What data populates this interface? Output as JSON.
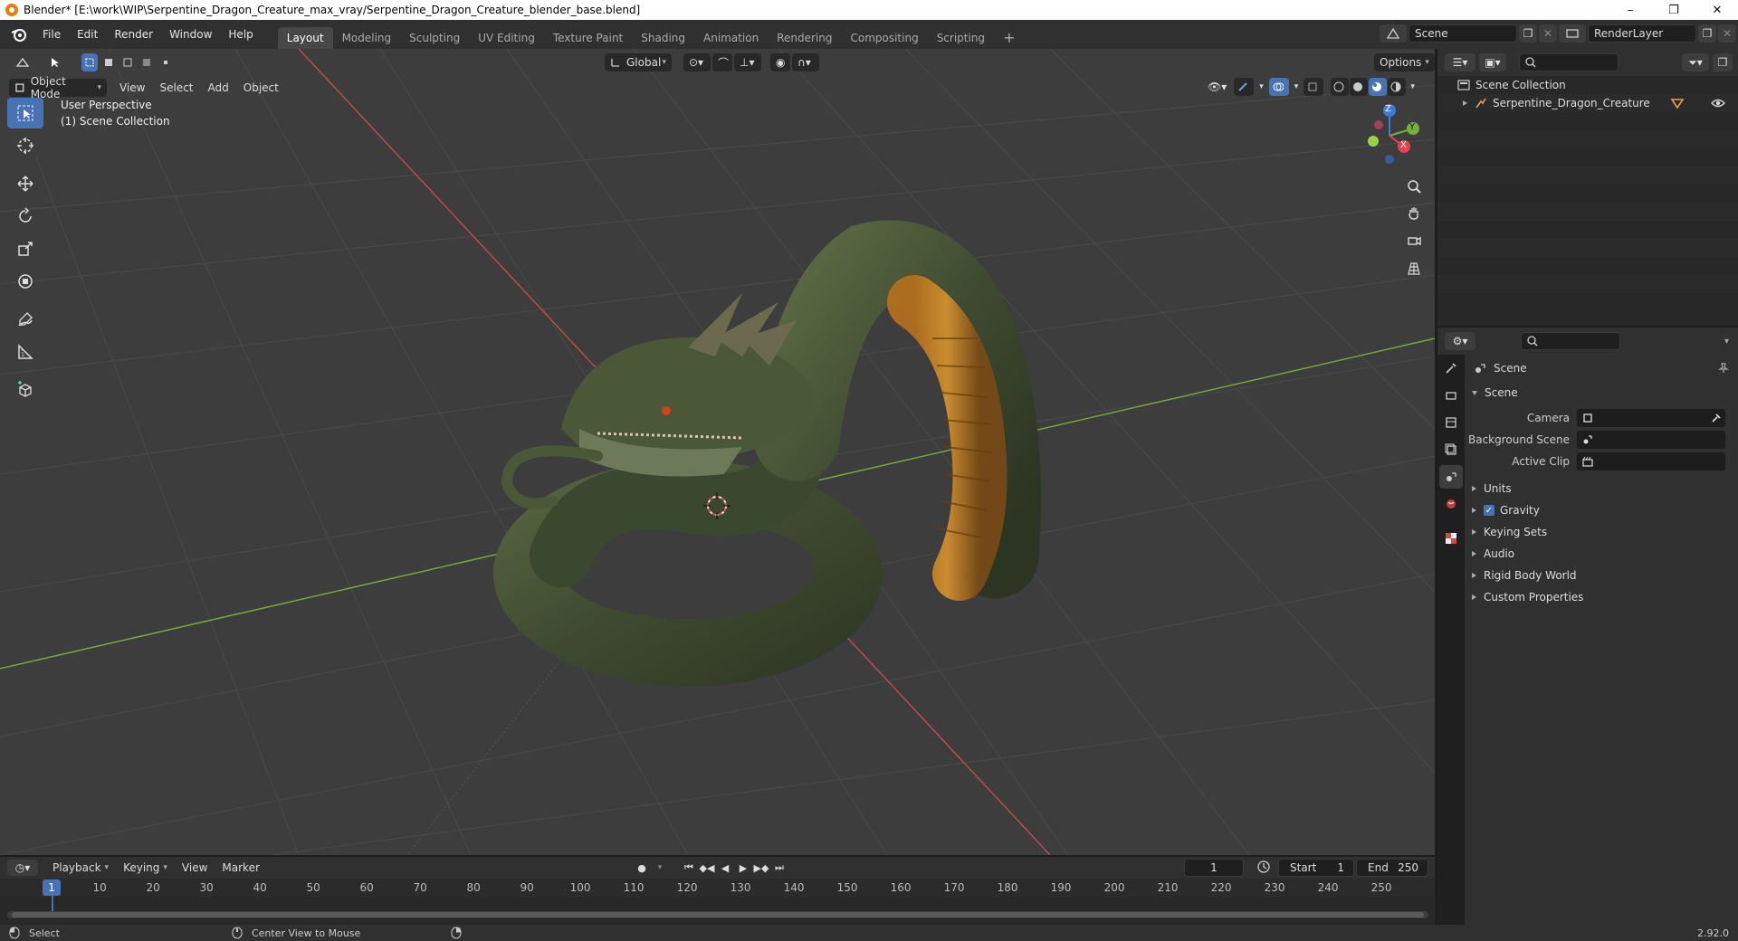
{
  "window": {
    "title": "Blender* [E:\\work\\WIP\\Serpentine_Dragon_Creature_max_vray/Serpentine_Dragon_Creature_blender_base.blend]",
    "minimize": "–",
    "maximize": "❐",
    "close": "✕"
  },
  "menu": [
    "File",
    "Edit",
    "Render",
    "Window",
    "Help"
  ],
  "workspaces": [
    {
      "label": "Layout",
      "active": true
    },
    {
      "label": "Modeling"
    },
    {
      "label": "Sculpting"
    },
    {
      "label": "UV Editing"
    },
    {
      "label": "Texture Paint"
    },
    {
      "label": "Shading"
    },
    {
      "label": "Animation"
    },
    {
      "label": "Rendering"
    },
    {
      "label": "Compositing"
    },
    {
      "label": "Scripting"
    }
  ],
  "add_workspace": "+",
  "scene_field": "Scene",
  "renderlayer_field": "RenderLayer",
  "viewport": {
    "transform_orientation": "Global",
    "options_label": "Options",
    "mode": "Object Mode",
    "menus": [
      "View",
      "Select",
      "Add",
      "Object"
    ],
    "overlay_line1": "User Perspective",
    "overlay_line2": "(1) Scene Collection",
    "gizmo": {
      "z": "Z",
      "y": "Y",
      "x": "X"
    }
  },
  "outliner": {
    "root": "Scene Collection",
    "items": [
      {
        "label": "Serpentine_Dragon_Creature"
      }
    ]
  },
  "properties": {
    "context_title": "Scene",
    "section_scene": "Scene",
    "fields": [
      {
        "label": "Camera",
        "value": ""
      },
      {
        "label": "Background Scene",
        "value": ""
      },
      {
        "label": "Active Clip",
        "value": ""
      }
    ],
    "panels": [
      {
        "label": "Units",
        "checkbox": false
      },
      {
        "label": "Gravity",
        "checkbox": true
      },
      {
        "label": "Keying Sets",
        "checkbox": false
      },
      {
        "label": "Audio",
        "checkbox": false
      },
      {
        "label": "Rigid Body World",
        "checkbox": false
      },
      {
        "label": "Custom Properties",
        "checkbox": false
      }
    ]
  },
  "timeline": {
    "menus": [
      "Playback",
      "Keying",
      "View",
      "Marker"
    ],
    "current_frame": "1",
    "start_label": "Start",
    "start_value": "1",
    "end_label": "End",
    "end_value": "250",
    "ruler_labels": [
      "1",
      "10",
      "20",
      "30",
      "40",
      "50",
      "60",
      "70",
      "80",
      "90",
      "100",
      "110",
      "120",
      "130",
      "140",
      "150",
      "160",
      "170",
      "180",
      "190",
      "200",
      "210",
      "220",
      "230",
      "240",
      "250"
    ]
  },
  "status": {
    "left": "Select",
    "middle": "Center View to Mouse",
    "version": "2.92.0"
  },
  "colors": {
    "accent": "#4772b3",
    "grid_bg": "#3d3d3d",
    "x_axis": "#c84a4a",
    "y_axis": "#7aae3c",
    "gizmo_x": "#e8414f",
    "gizmo_y": "#73b03e",
    "gizmo_z": "#3a7cd9"
  }
}
